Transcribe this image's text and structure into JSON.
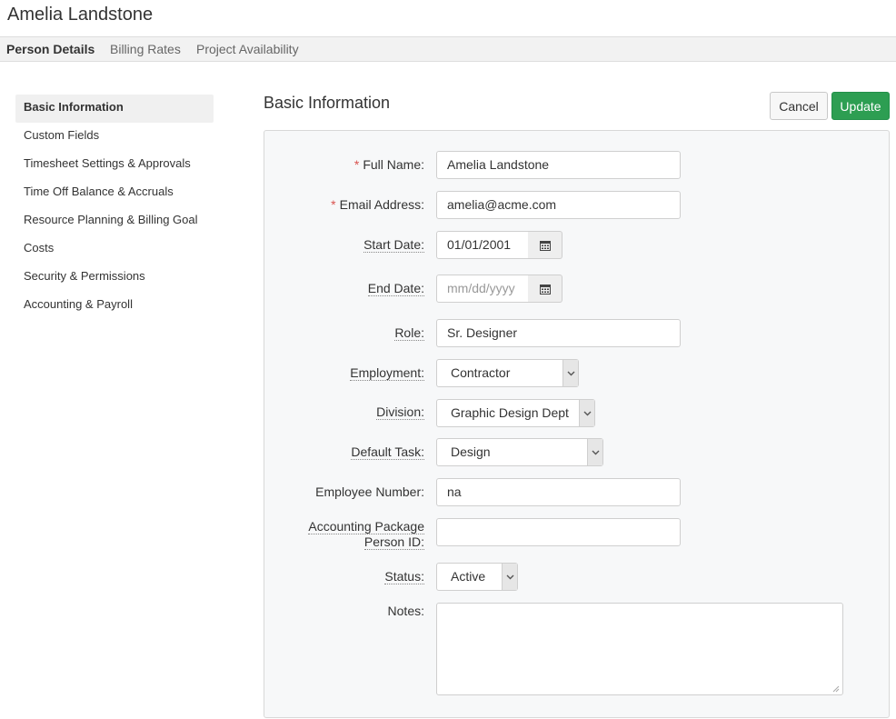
{
  "header": {
    "title": "Amelia Landstone"
  },
  "tabs": [
    {
      "label": "Person Details",
      "active": true
    },
    {
      "label": "Billing Rates",
      "active": false
    },
    {
      "label": "Project Availability",
      "active": false
    }
  ],
  "sidebar": {
    "items": [
      {
        "label": "Basic Information",
        "active": true
      },
      {
        "label": "Custom Fields"
      },
      {
        "label": "Timesheet Settings & Approvals"
      },
      {
        "label": "Time Off Balance & Accruals"
      },
      {
        "label": "Resource Planning & Billing Goal"
      },
      {
        "label": "Costs"
      },
      {
        "label": "Security & Permissions"
      },
      {
        "label": "Accounting & Payroll"
      }
    ]
  },
  "section": {
    "title": "Basic Information"
  },
  "actions": {
    "cancel_label": "Cancel",
    "update_label": "Update"
  },
  "colors": {
    "update_button": "#2d9e52",
    "required_marker": "#d9534f"
  },
  "form": {
    "full_name": {
      "label": "Full Name:",
      "required": "*",
      "value": "Amelia Landstone"
    },
    "email": {
      "label": "Email Address:",
      "required": "*",
      "value": "amelia@acme.com"
    },
    "start_date": {
      "label": "Start Date:",
      "value": "01/01/2001",
      "icon": "calendar-icon"
    },
    "end_date": {
      "label": "End Date:",
      "placeholder": "mm/dd/yyyy",
      "icon": "calendar-icon"
    },
    "role": {
      "label": "Role:",
      "value": "Sr. Designer"
    },
    "employment": {
      "label": "Employment:",
      "value": "Contractor"
    },
    "division": {
      "label": "Division:",
      "value": "Graphic Design Dept"
    },
    "default_task": {
      "label": "Default Task:",
      "value": "Design"
    },
    "employee_number": {
      "label": "Employee Number:",
      "value": "na"
    },
    "accounting_id": {
      "label_line1": "Accounting Package",
      "label_line2": "Person ID:",
      "value": ""
    },
    "status": {
      "label": "Status:",
      "value": "Active"
    },
    "notes": {
      "label": "Notes:",
      "value": ""
    }
  }
}
